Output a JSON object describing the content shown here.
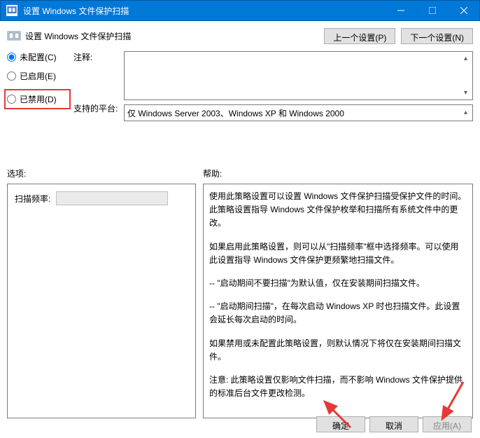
{
  "titlebar": {
    "title": "设置 Windows 文件保护扫描"
  },
  "header": {
    "title": "设置 Windows 文件保护扫描",
    "prev": "上一个设置(P)",
    "next": "下一个设置(N)"
  },
  "radios": {
    "unconfigured": "未配置(C)",
    "enabled": "已启用(E)",
    "disabled": "已禁用(D)"
  },
  "labels": {
    "comment": "注释:",
    "platform": "支持的平台:",
    "options": "选项:",
    "help": "帮助:",
    "scan_freq": "扫描频率:"
  },
  "fields": {
    "comment_value": "",
    "platform_value": "仅 Windows Server 2003、Windows XP 和 Windows 2000"
  },
  "help": {
    "p1": "使用此策略设置可以设置 Windows 文件保护扫描受保护文件的时间。此策略设置指导 Windows 文件保护枚举和扫描所有系统文件中的更改。",
    "p2": "如果启用此策略设置，则可以从\"扫描频率\"框中选择频率。可以使用此设置指导 Windows 文件保护更频繁地扫描文件。",
    "p3": "-- \"启动期间不要扫描\"为默认值，仅在安装期间扫描文件。",
    "p4": "-- \"启动期间扫描\"，在每次启动 Windows XP 时也扫描文件。此设置会延长每次启动的时间。",
    "p5": "如果禁用或未配置此策略设置，则默认情况下将仅在安装期间扫描文件。",
    "p6": "注意: 此策略设置仅影响文件扫描，而不影响 Windows 文件保护提供的标准后台文件更改检测。"
  },
  "footer": {
    "ok": "确定",
    "cancel": "取消",
    "apply": "应用(A)"
  }
}
